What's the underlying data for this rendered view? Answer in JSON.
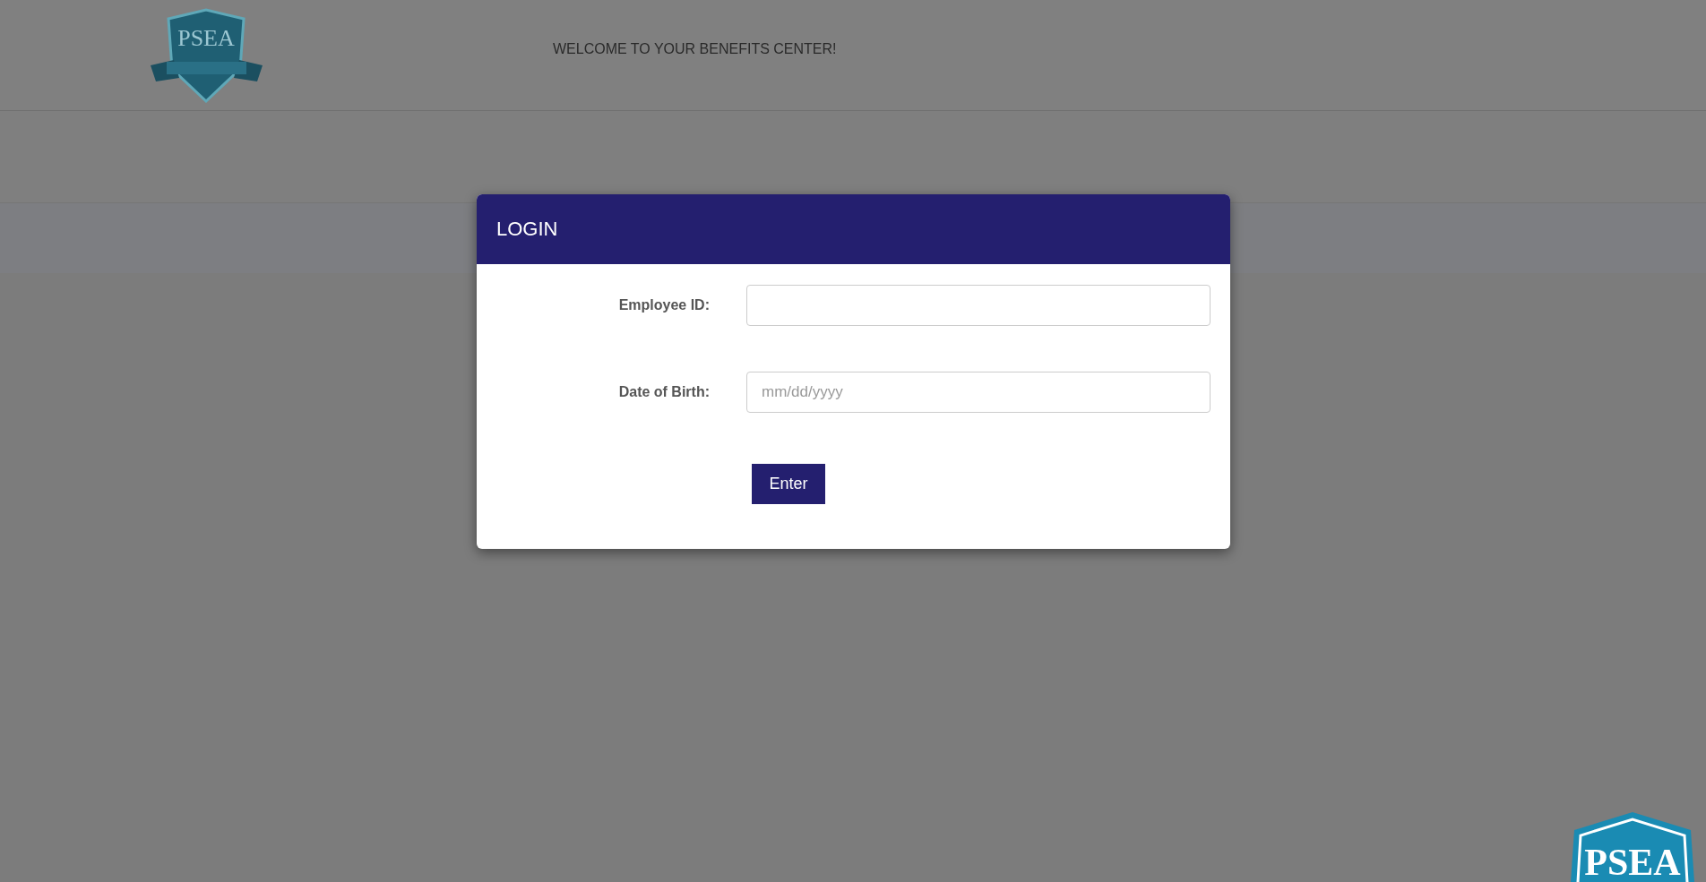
{
  "header": {
    "logo_text": "PSEA",
    "title": "WELCOME TO YOUR BENEFITS CENTER!"
  },
  "login": {
    "title": "LOGIN",
    "fields": [
      {
        "label": "Employee ID:"
      },
      {
        "label": "Date of Birth:",
        "placeholder": "mm/dd/yyyy"
      }
    ],
    "button": "Enter"
  },
  "corner_logo_text": "PSEA"
}
